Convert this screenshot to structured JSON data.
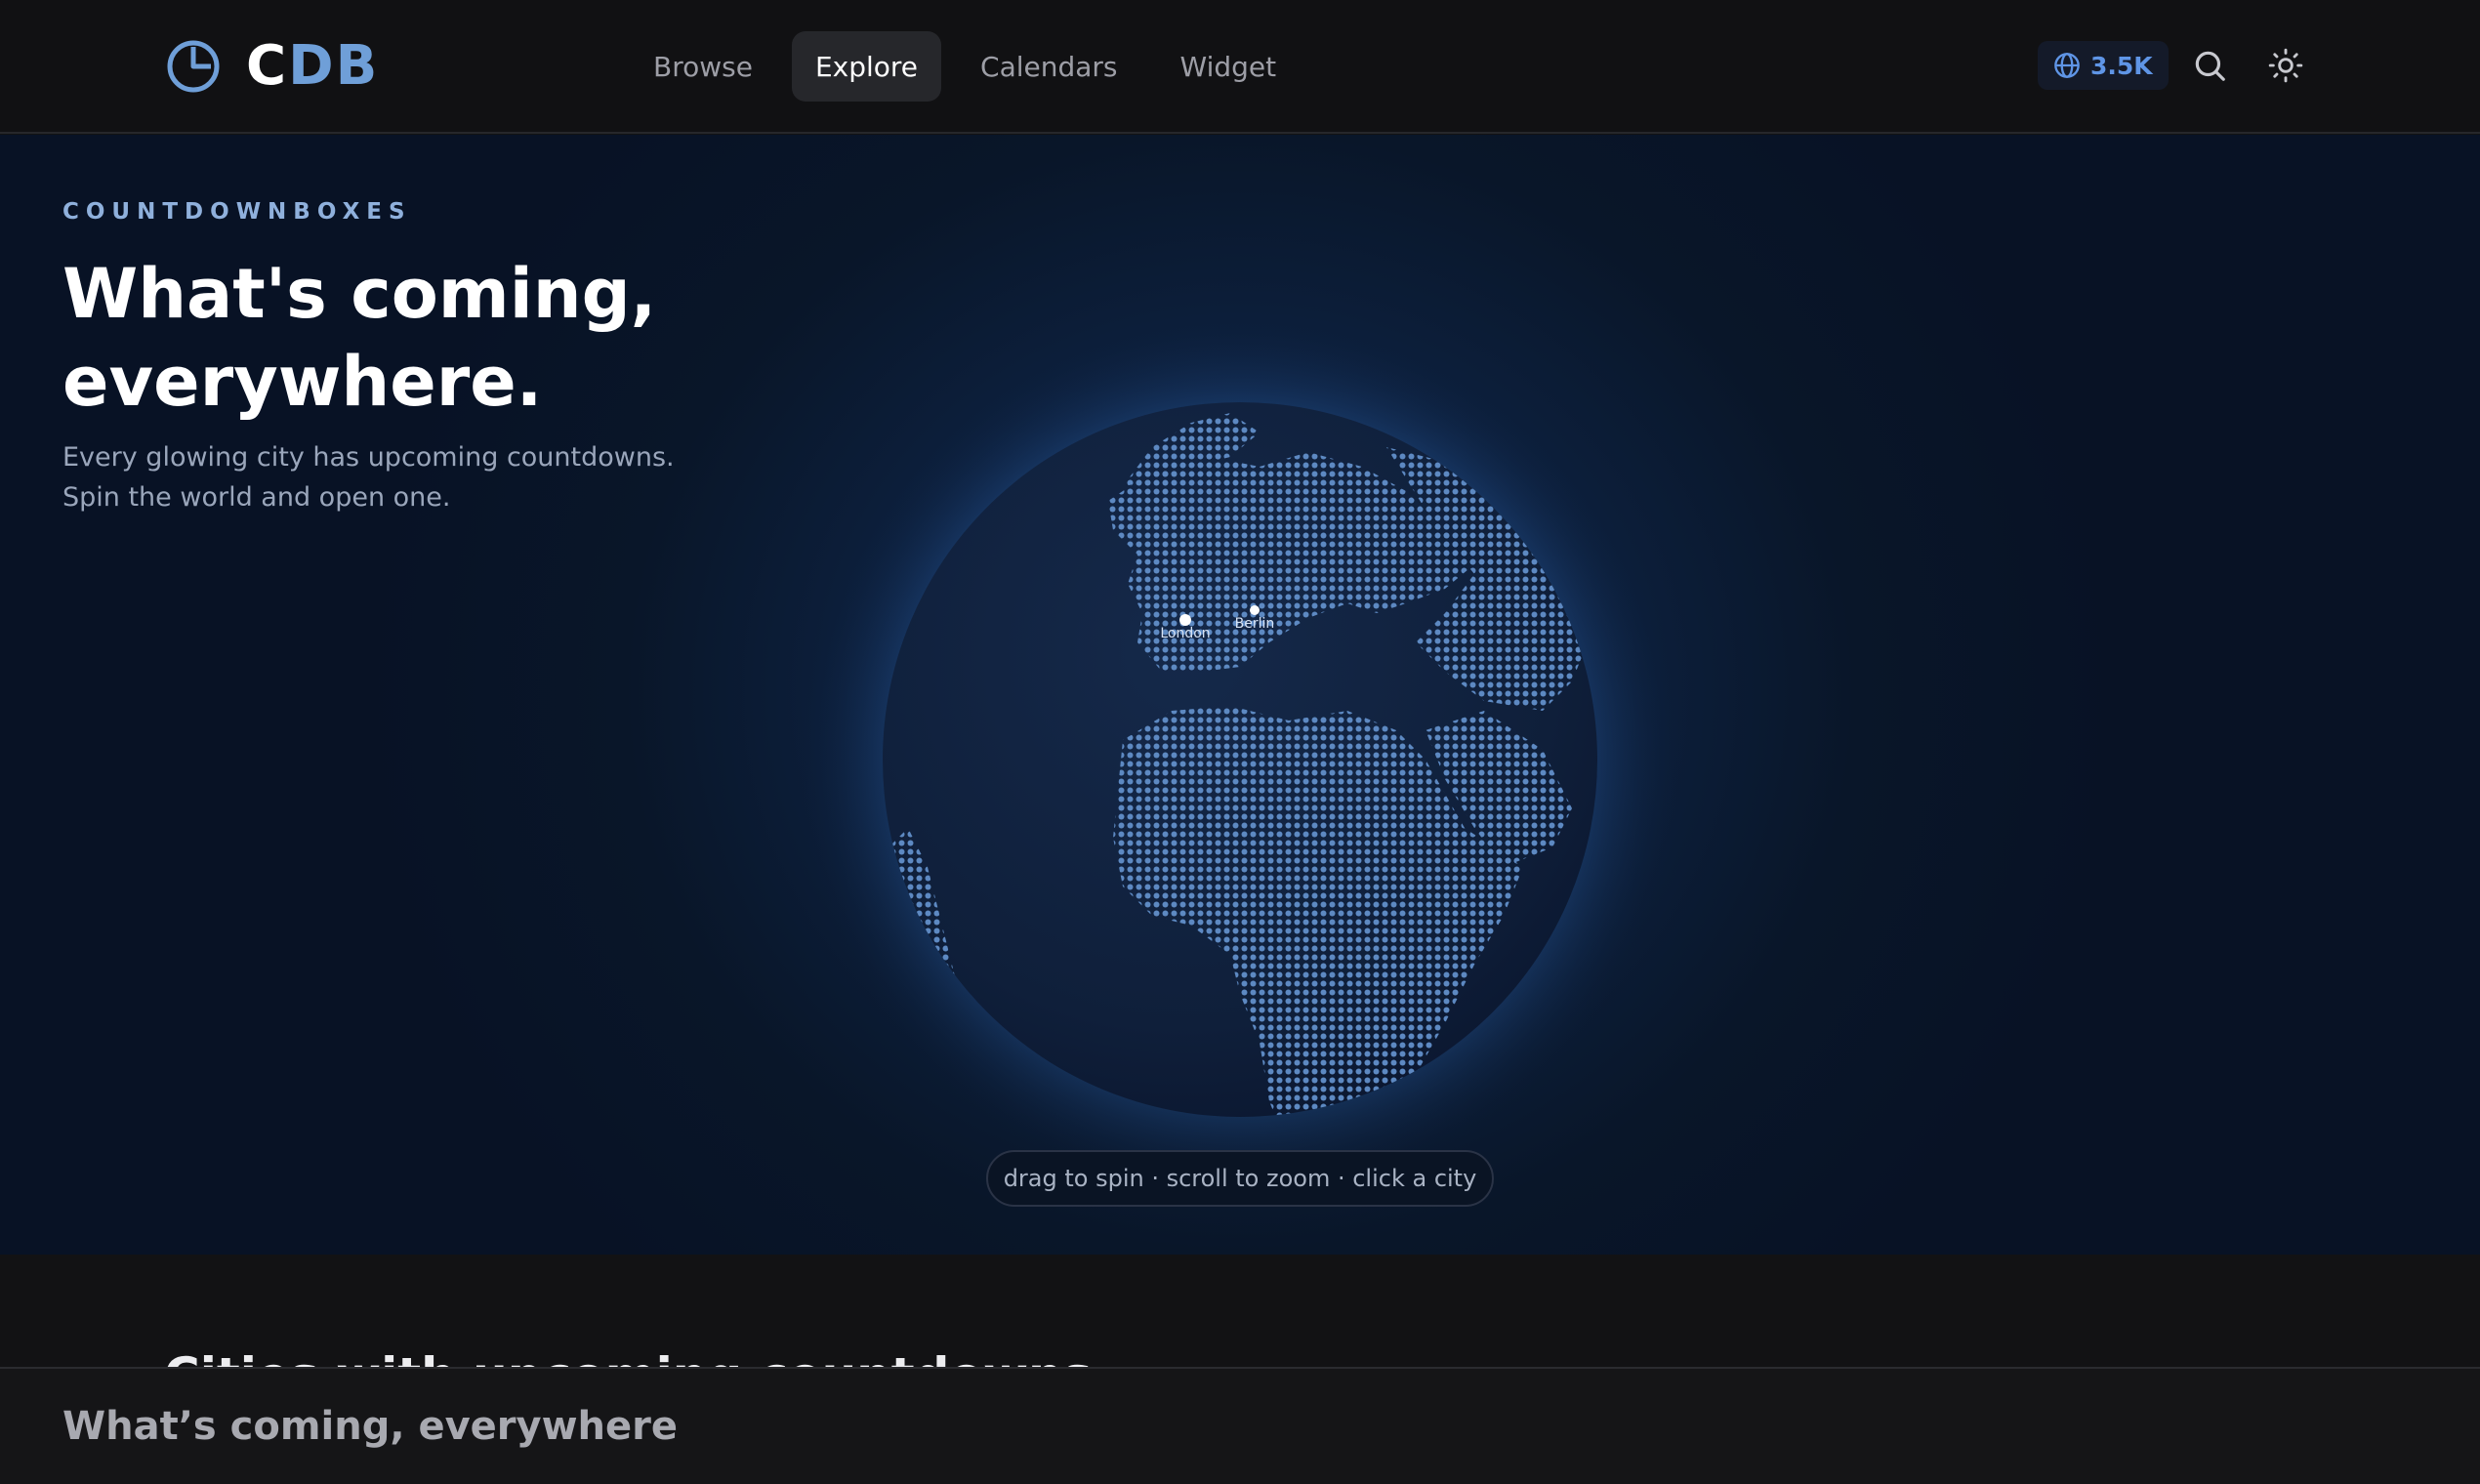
{
  "brand": {
    "logo_c": "C",
    "logo_db": "DB"
  },
  "nav": {
    "items": [
      {
        "label": "Browse"
      },
      {
        "label": "Explore"
      },
      {
        "label": "Calendars"
      },
      {
        "label": "Widget"
      }
    ],
    "active": "Explore"
  },
  "header": {
    "badge_value": "3.5K",
    "icons": [
      "globe-icon",
      "search-icon",
      "sun-icon"
    ]
  },
  "hero": {
    "eyebrow": "COUNTDOWNBOXES",
    "headline_line1": "What's coming,",
    "headline_line2": "everywhere.",
    "sub_line1": "Every glowing city has upcoming countdowns.",
    "sub_line2": "Spin the world and open one.",
    "hint": "drag to spin · scroll to zoom · click a city"
  },
  "globe": {
    "cities": [
      {
        "name": "London"
      },
      {
        "name": "Berlin"
      }
    ]
  },
  "section": {
    "title": "Cities with upcoming countdowns"
  },
  "sticky_bar": {
    "title": "What’s coming, everywhere"
  },
  "colors": {
    "accent": "#6f9fd8",
    "badge": "#5f95e6",
    "background": "#121214",
    "hero_bg": "#0d2140"
  }
}
